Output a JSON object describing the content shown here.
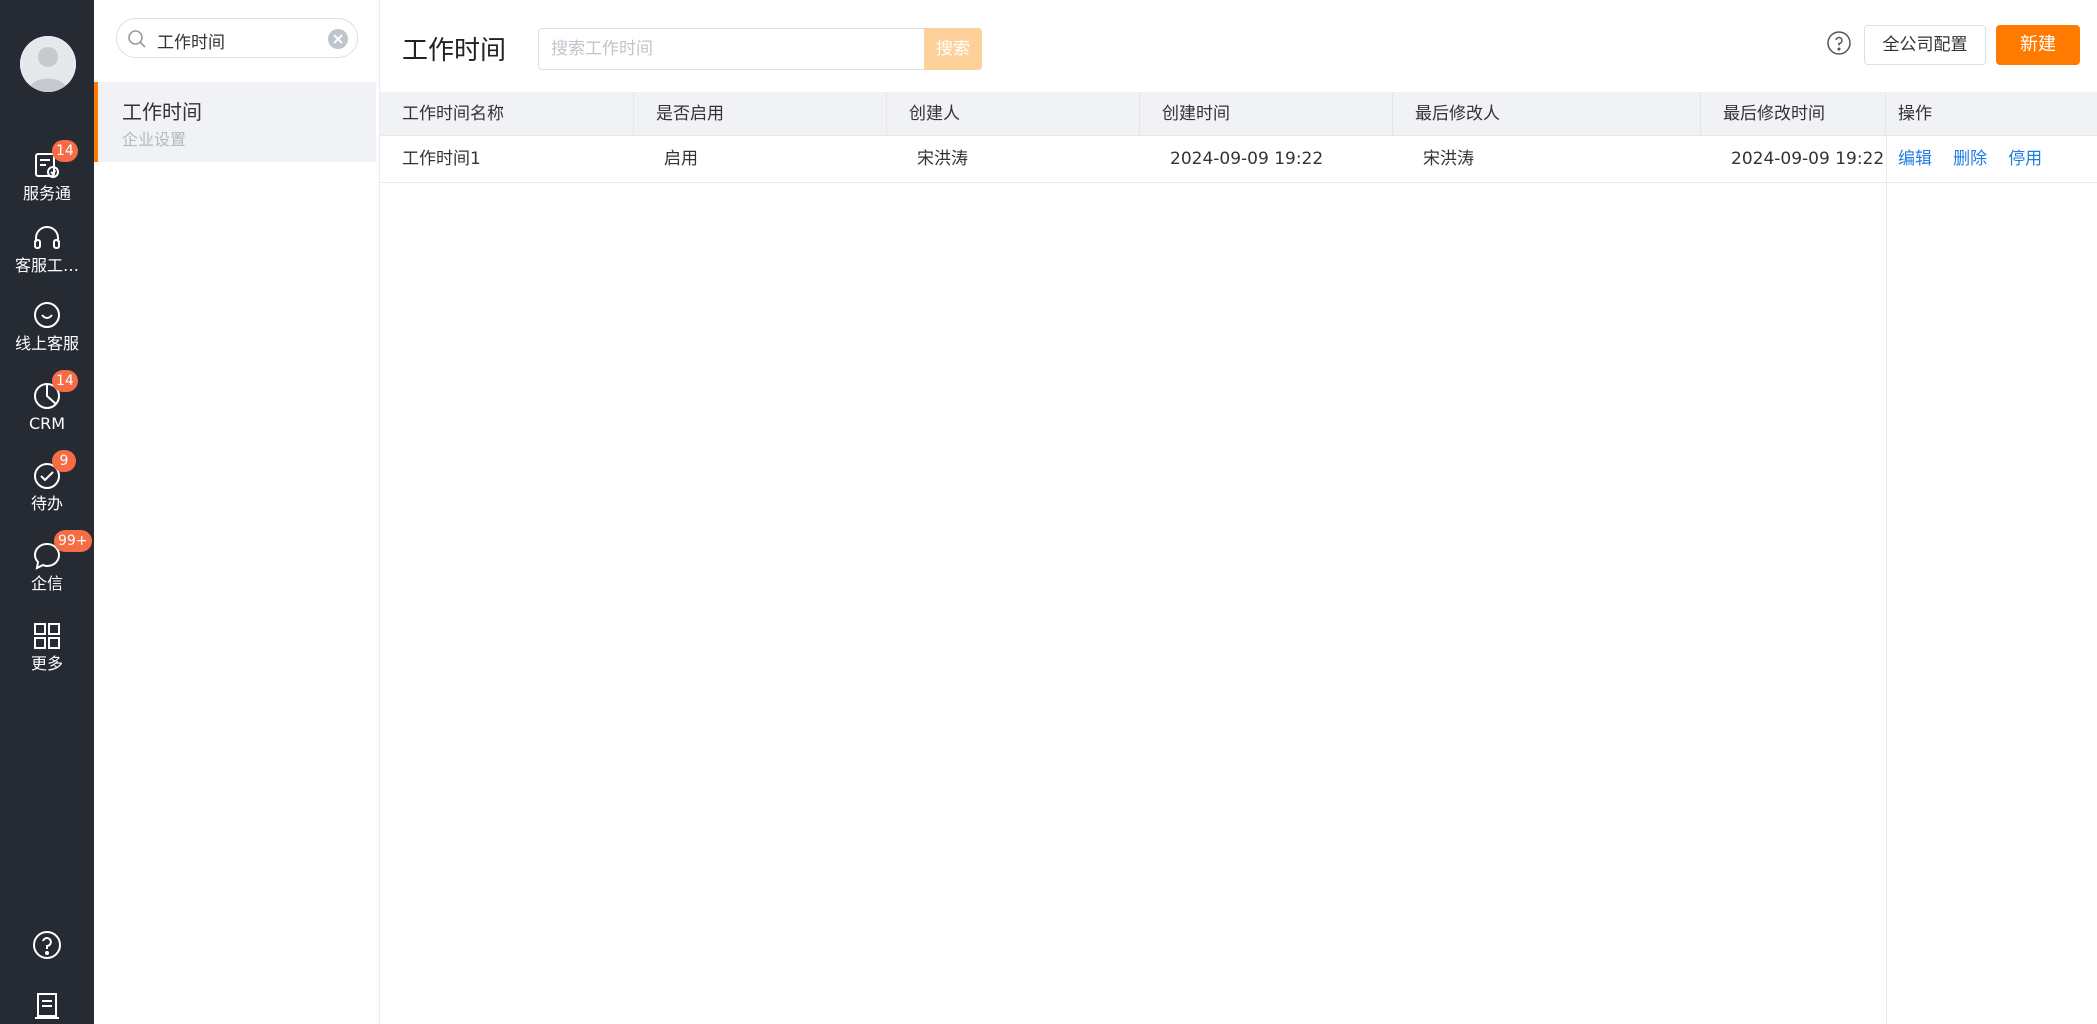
{
  "rail": {
    "items": [
      {
        "icon": "service-icon",
        "label": "服务通",
        "badge": "14"
      },
      {
        "icon": "headset-icon",
        "label": "客服工…",
        "badge": ""
      },
      {
        "icon": "smile-chat-icon",
        "label": "线上客服",
        "badge": ""
      },
      {
        "icon": "pie-chart-icon",
        "label": "CRM",
        "badge": "14"
      },
      {
        "icon": "check-circle-icon",
        "label": "待办",
        "badge": "9"
      },
      {
        "icon": "chat-bubble-icon",
        "label": "企信",
        "badge": "99+"
      },
      {
        "icon": "grid-icon",
        "label": "更多",
        "badge": ""
      }
    ],
    "bottom": [
      "help-icon",
      "notebook-icon"
    ]
  },
  "sidebar": {
    "search_value": "工作时间",
    "menu": [
      {
        "title": "工作时间",
        "subtitle": "企业设置"
      }
    ]
  },
  "header": {
    "title": "工作时间",
    "search_placeholder": "搜索工作时间",
    "search_button": "搜索",
    "config_button": "全公司配置",
    "new_button": "新建"
  },
  "table": {
    "columns": [
      "工作时间名称",
      "是否启用",
      "创建人",
      "创建时间",
      "最后修改人",
      "最后修改时间",
      "操作"
    ],
    "rows": [
      {
        "name": "工作时间1",
        "enabled": "启用",
        "creator": "宋洪涛",
        "created_at": "2024-09-09 19:22",
        "modifier": "宋洪涛",
        "modified_at": "2024-09-09 19:22",
        "actions": [
          "编辑",
          "删除",
          "停用"
        ]
      }
    ]
  },
  "colors": {
    "rail_bg": "#252a33",
    "accent": "#ff7a00",
    "badge": "#f56c45",
    "link": "#1f7de0",
    "search_btn": "#fdd199"
  }
}
